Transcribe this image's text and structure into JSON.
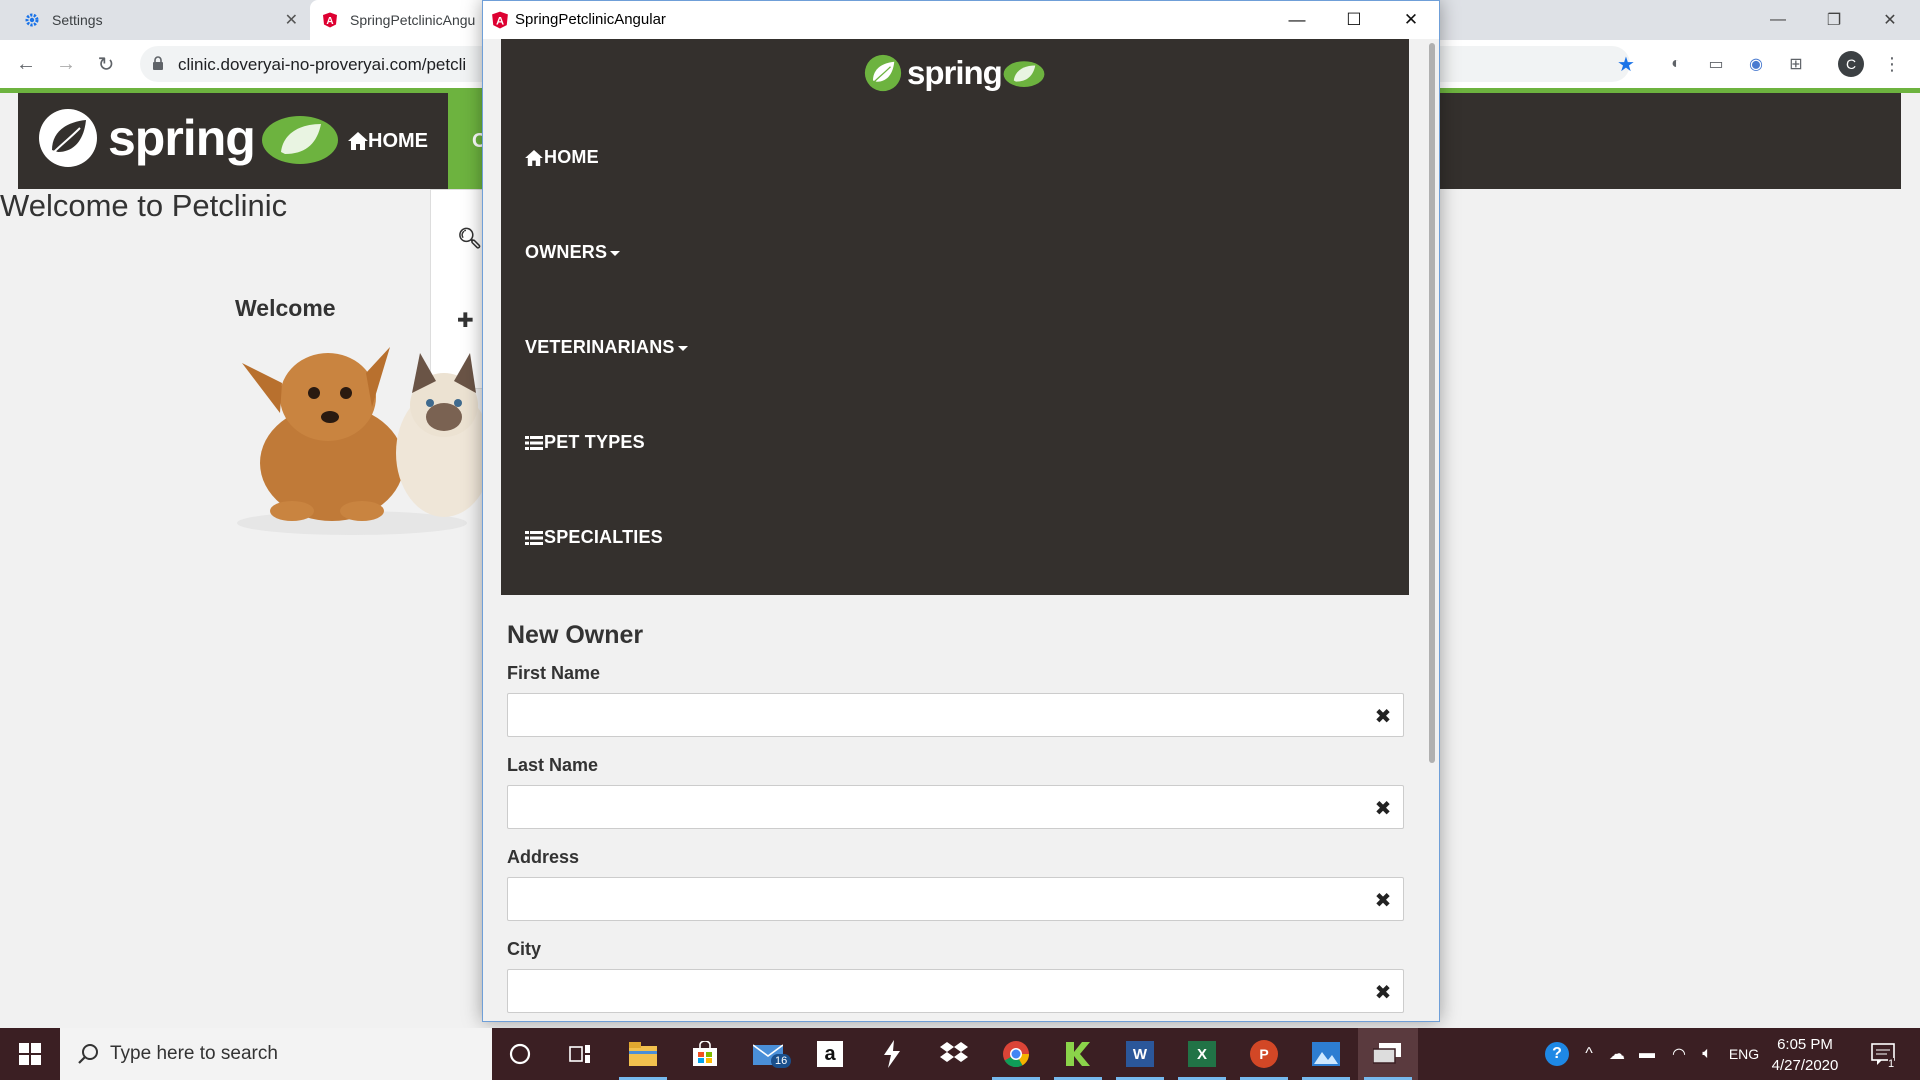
{
  "browser": {
    "tabs": [
      {
        "title": "Settings",
        "icon": "gear-icon"
      },
      {
        "title": "SpringPetclinicAngu",
        "icon": "angular-icon"
      }
    ],
    "url": "clinic.doveryai-no-proveryai.com/petcli",
    "profile_initial": "C"
  },
  "background_page": {
    "logo_text": "spring",
    "nav_home": "HOME",
    "nav_owners": "OW",
    "title": "Welcome to Petclinic",
    "welcome": "Welcome",
    "dropdown_items": [
      "Q",
      "+"
    ]
  },
  "popup": {
    "window_title": "SpringPetclinicAngular",
    "logo_text": "spring",
    "nav": {
      "home": "HOME",
      "owners": "OWNERS",
      "veterinarians": "VETERINARIANS",
      "pet_types": "PET TYPES",
      "specialties": "SPECIALTIES"
    },
    "form": {
      "title": "New Owner",
      "fields": [
        {
          "label": "First Name",
          "value": ""
        },
        {
          "label": "Last Name",
          "value": ""
        },
        {
          "label": "Address",
          "value": ""
        },
        {
          "label": "City",
          "value": ""
        }
      ]
    }
  },
  "taskbar": {
    "search_placeholder": "Type here to search",
    "mail_badge": "16",
    "language": "ENG",
    "time": "6:05 PM",
    "date": "4/27/2020",
    "notification_count": "1"
  },
  "colors": {
    "spring_dark": "#34302d",
    "spring_green": "#6db33f",
    "taskbar": "#3b1f23"
  }
}
